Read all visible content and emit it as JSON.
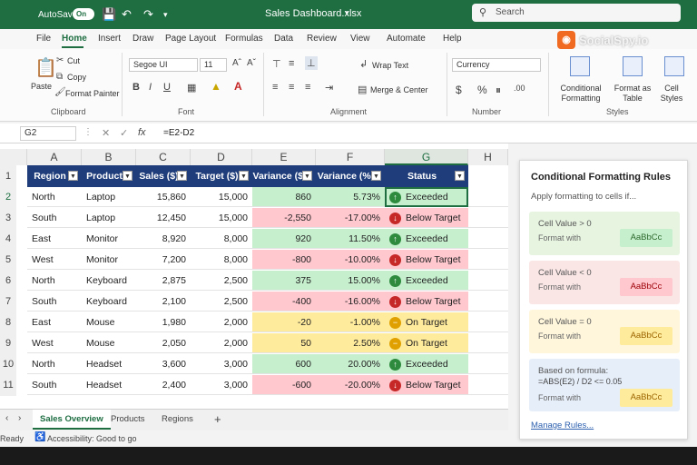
{
  "title_bar": {
    "autosave_label": "AutoSave",
    "autosave_state": "On",
    "doc_title": "Sales Dashboard.xlsx",
    "search_placeholder": "Search"
  },
  "brand": {
    "logo_text": "SocialSpy.io",
    "logo_color": "#f06a22"
  },
  "ribbon_tabs": [
    "File",
    "Home",
    "Insert",
    "Draw",
    "Page Layout",
    "Formulas",
    "Data",
    "Review",
    "View",
    "Automate",
    "Help"
  ],
  "active_tab": "Home",
  "ribbon": {
    "clipboard": {
      "paste": "Paste",
      "cut": "Cut",
      "copy": "Copy",
      "format_painter": "Format Painter",
      "label": "Clipboard"
    },
    "font": {
      "family": "Segoe UI",
      "size": "11",
      "label": "Font"
    },
    "alignment": {
      "wrap_text": "Wrap Text",
      "merge_center": "Merge & Center",
      "label": "Alignment"
    },
    "number": {
      "format": "Currency",
      "label": "Number"
    },
    "styles": {
      "conditional_formatting": "Conditional Formatting",
      "format_as_table": "Format as Table",
      "cell_styles": "Cell Styles",
      "label": "Styles"
    }
  },
  "formula_bar": {
    "name_box": "G2",
    "formula": "=E2-D2"
  },
  "grid": {
    "columns": [
      "A",
      "B",
      "C",
      "D",
      "E",
      "F",
      "G",
      "H"
    ],
    "selected_column": "G",
    "rows": [
      "1",
      "2",
      "3",
      "4",
      "5",
      "6",
      "7",
      "8",
      "9",
      "10",
      "11"
    ],
    "headers": [
      "Region",
      "Product",
      "Sales ($)",
      "Target ($)",
      "Variance ($)",
      "Variance (%)",
      "Status"
    ],
    "data": [
      [
        "North",
        "Laptop",
        "15,860",
        "15,000",
        "860",
        "5.73%",
        "Exceeded"
      ],
      [
        "South",
        "Laptop",
        "12,450",
        "15,000",
        "-2,550",
        "-17.00%",
        "Below Target"
      ],
      [
        "East",
        "Monitor",
        "8,920",
        "8,000",
        "920",
        "11.50%",
        "Exceeded"
      ],
      [
        "West",
        "Monitor",
        "7,200",
        "8,000",
        "-800",
        "-10.00%",
        "Below Target"
      ],
      [
        "North",
        "Keyboard",
        "2,875",
        "2,500",
        "375",
        "15.00%",
        "Exceeded"
      ],
      [
        "South",
        "Keyboard",
        "2,100",
        "2,500",
        "-400",
        "-16.00%",
        "Below Target"
      ],
      [
        "East",
        "Mouse",
        "1,980",
        "2,000",
        "-20",
        "-1.00%",
        "On Target"
      ],
      [
        "West",
        "Mouse",
        "2,050",
        "2,000",
        "50",
        "2.50%",
        "On Target"
      ],
      [
        "North",
        "Headset",
        "3,600",
        "3,000",
        "600",
        "20.00%",
        "Exceeded"
      ],
      [
        "South",
        "Headset",
        "2,400",
        "3,000",
        "-600",
        "-20.00%",
        "Below Target"
      ]
    ],
    "status_colors": {
      "Exceeded": "#c6efce",
      "Below Target": "#ffc7ce",
      "On Target": "#ffeb9c"
    },
    "header_color": "#1f3d7a"
  },
  "sheet_tabs": [
    "Sales Overview",
    "Products",
    "Regions"
  ],
  "active_sheet": "Sales Overview",
  "status_bar": {
    "ready": "Ready",
    "accessibility": "Accessibility: Good to go"
  },
  "panel": {
    "title": "Conditional Formatting Rules",
    "subtitle": "Apply formatting to cells if...",
    "rules": [
      {
        "condition": "Cell Value > 0",
        "format_label": "Format with",
        "sample": "AaBbCc",
        "bg": "#e6f4e0",
        "swatch": "#c6efce",
        "text": "#2e6b2e"
      },
      {
        "condition": "Cell Value < 0",
        "format_label": "Format with",
        "sample": "AaBbCc",
        "bg": "#fbe6e6",
        "swatch": "#ffc7ce",
        "text": "#9c0006"
      },
      {
        "condition": "Cell Value = 0",
        "format_label": "Format with",
        "sample": "AaBbCc",
        "bg": "#fff6dc",
        "swatch": "#ffeb9c",
        "text": "#9c6500"
      },
      {
        "condition": "Based on formula:",
        "formula": "=ABS(E2) / D2 <= 0.05",
        "format_label": "Format with",
        "sample": "AaBbCc",
        "bg": "#e6eefa",
        "swatch": "#ffeb9c",
        "text": "#9c6500"
      }
    ],
    "manage_link": "Manage Rules..."
  }
}
